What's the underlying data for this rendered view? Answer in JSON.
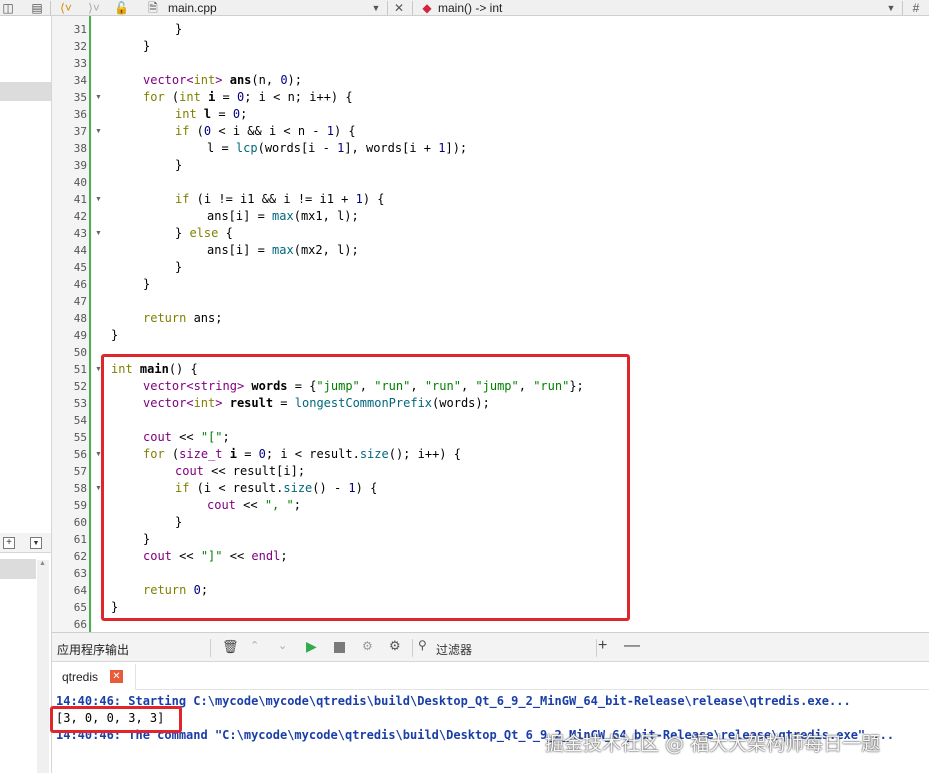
{
  "toolbar": {
    "file_tab": "main.cpp",
    "symbol": "main() -> int",
    "hash": "#"
  },
  "editor": {
    "lines": [
      {
        "n": "31",
        "indent": 2,
        "fold": false,
        "tokens": [
          {
            "t": "}"
          }
        ]
      },
      {
        "n": "32",
        "indent": 1,
        "fold": false,
        "tokens": [
          {
            "t": "}"
          }
        ]
      },
      {
        "n": "33",
        "indent": 0,
        "fold": false,
        "tokens": []
      },
      {
        "n": "34",
        "indent": 1,
        "fold": false,
        "tokens": [
          {
            "t": "vector<",
            "c": "ty"
          },
          {
            "t": "int",
            "c": "kw"
          },
          {
            "t": "> ",
            "c": "ty"
          },
          {
            "t": "ans",
            "c": "bd"
          },
          {
            "t": "(n, "
          },
          {
            "t": "0",
            "c": "nu"
          },
          {
            "t": ");"
          }
        ]
      },
      {
        "n": "35",
        "indent": 1,
        "fold": true,
        "tokens": [
          {
            "t": "for",
            "c": "kw"
          },
          {
            "t": " ("
          },
          {
            "t": "int",
            "c": "kw"
          },
          {
            "t": " "
          },
          {
            "t": "i",
            "c": "bd"
          },
          {
            "t": " = "
          },
          {
            "t": "0",
            "c": "nu"
          },
          {
            "t": "; i < n; i++) {"
          }
        ]
      },
      {
        "n": "36",
        "indent": 2,
        "fold": false,
        "tokens": [
          {
            "t": "int",
            "c": "kw"
          },
          {
            "t": " "
          },
          {
            "t": "l",
            "c": "bd"
          },
          {
            "t": " = "
          },
          {
            "t": "0",
            "c": "nu"
          },
          {
            "t": ";"
          }
        ]
      },
      {
        "n": "37",
        "indent": 2,
        "fold": true,
        "tokens": [
          {
            "t": "if",
            "c": "kw"
          },
          {
            "t": " ("
          },
          {
            "t": "0",
            "c": "nu"
          },
          {
            "t": " < i && i < n - "
          },
          {
            "t": "1",
            "c": "nu"
          },
          {
            "t": ") {"
          }
        ]
      },
      {
        "n": "38",
        "indent": 3,
        "fold": false,
        "tokens": [
          {
            "t": "l = "
          },
          {
            "t": "lcp",
            "c": "fn"
          },
          {
            "t": "(words[i - "
          },
          {
            "t": "1",
            "c": "nu"
          },
          {
            "t": "], words[i + "
          },
          {
            "t": "1",
            "c": "nu"
          },
          {
            "t": "]);"
          }
        ]
      },
      {
        "n": "39",
        "indent": 2,
        "fold": false,
        "tokens": [
          {
            "t": "}"
          }
        ]
      },
      {
        "n": "40",
        "indent": 0,
        "fold": false,
        "tokens": []
      },
      {
        "n": "41",
        "indent": 2,
        "fold": true,
        "tokens": [
          {
            "t": "if",
            "c": "kw"
          },
          {
            "t": " (i != i1 && i != i1 + "
          },
          {
            "t": "1",
            "c": "nu"
          },
          {
            "t": ") {"
          }
        ]
      },
      {
        "n": "42",
        "indent": 3,
        "fold": false,
        "tokens": [
          {
            "t": "ans[i] = "
          },
          {
            "t": "max",
            "c": "fn"
          },
          {
            "t": "(mx1, l);"
          }
        ]
      },
      {
        "n": "43",
        "indent": 2,
        "fold": true,
        "tokens": [
          {
            "t": "} "
          },
          {
            "t": "else",
            "c": "kw"
          },
          {
            "t": " {"
          }
        ]
      },
      {
        "n": "44",
        "indent": 3,
        "fold": false,
        "tokens": [
          {
            "t": "ans[i] = "
          },
          {
            "t": "max",
            "c": "fn"
          },
          {
            "t": "(mx2, l);"
          }
        ]
      },
      {
        "n": "45",
        "indent": 2,
        "fold": false,
        "tokens": [
          {
            "t": "}"
          }
        ]
      },
      {
        "n": "46",
        "indent": 1,
        "fold": false,
        "tokens": [
          {
            "t": "}"
          }
        ]
      },
      {
        "n": "47",
        "indent": 0,
        "fold": false,
        "tokens": []
      },
      {
        "n": "48",
        "indent": 1,
        "fold": false,
        "tokens": [
          {
            "t": "return",
            "c": "kw"
          },
          {
            "t": " ans;"
          }
        ]
      },
      {
        "n": "49",
        "indent": 0,
        "fold": false,
        "tokens": [
          {
            "t": "}"
          }
        ]
      },
      {
        "n": "50",
        "indent": 0,
        "fold": false,
        "tokens": []
      },
      {
        "n": "51",
        "indent": 0,
        "fold": true,
        "tokens": [
          {
            "t": "int",
            "c": "kw"
          },
          {
            "t": " "
          },
          {
            "t": "main",
            "c": "bd"
          },
          {
            "t": "() {"
          }
        ]
      },
      {
        "n": "52",
        "indent": 1,
        "fold": false,
        "tokens": [
          {
            "t": "vector<",
            "c": "ty"
          },
          {
            "t": "string",
            "c": "ty"
          },
          {
            "t": "> ",
            "c": "ty"
          },
          {
            "t": "words",
            "c": "bd"
          },
          {
            "t": " = {"
          },
          {
            "t": "\"jump\"",
            "c": "st"
          },
          {
            "t": ", "
          },
          {
            "t": "\"run\"",
            "c": "st"
          },
          {
            "t": ", "
          },
          {
            "t": "\"run\"",
            "c": "st"
          },
          {
            "t": ", "
          },
          {
            "t": "\"jump\"",
            "c": "st"
          },
          {
            "t": ", "
          },
          {
            "t": "\"run\"",
            "c": "st"
          },
          {
            "t": "};"
          }
        ]
      },
      {
        "n": "53",
        "indent": 1,
        "fold": false,
        "tokens": [
          {
            "t": "vector<",
            "c": "ty"
          },
          {
            "t": "int",
            "c": "kw"
          },
          {
            "t": "> ",
            "c": "ty"
          },
          {
            "t": "result",
            "c": "bd"
          },
          {
            "t": " = "
          },
          {
            "t": "longestCommonPrefix",
            "c": "fn"
          },
          {
            "t": "(words);"
          }
        ]
      },
      {
        "n": "54",
        "indent": 0,
        "fold": false,
        "tokens": []
      },
      {
        "n": "55",
        "indent": 1,
        "fold": false,
        "tokens": [
          {
            "t": "cout",
            "c": "ty"
          },
          {
            "t": " << "
          },
          {
            "t": "\"[\"",
            "c": "st"
          },
          {
            "t": ";"
          }
        ]
      },
      {
        "n": "56",
        "indent": 1,
        "fold": true,
        "tokens": [
          {
            "t": "for",
            "c": "kw"
          },
          {
            "t": " ("
          },
          {
            "t": "size_t",
            "c": "ty"
          },
          {
            "t": " "
          },
          {
            "t": "i",
            "c": "bd"
          },
          {
            "t": " = "
          },
          {
            "t": "0",
            "c": "nu"
          },
          {
            "t": "; i < result."
          },
          {
            "t": "size",
            "c": "fn"
          },
          {
            "t": "(); i++) {"
          }
        ]
      },
      {
        "n": "57",
        "indent": 2,
        "fold": false,
        "tokens": [
          {
            "t": "cout",
            "c": "ty"
          },
          {
            "t": " << result[i];"
          }
        ]
      },
      {
        "n": "58",
        "indent": 2,
        "fold": true,
        "tokens": [
          {
            "t": "if",
            "c": "kw"
          },
          {
            "t": " (i < result."
          },
          {
            "t": "size",
            "c": "fn"
          },
          {
            "t": "() - "
          },
          {
            "t": "1",
            "c": "nu"
          },
          {
            "t": ") {"
          }
        ]
      },
      {
        "n": "59",
        "indent": 3,
        "fold": false,
        "tokens": [
          {
            "t": "cout",
            "c": "ty"
          },
          {
            "t": " << "
          },
          {
            "t": "\", \"",
            "c": "st"
          },
          {
            "t": ";"
          }
        ]
      },
      {
        "n": "60",
        "indent": 2,
        "fold": false,
        "tokens": [
          {
            "t": "}"
          }
        ]
      },
      {
        "n": "61",
        "indent": 1,
        "fold": false,
        "tokens": [
          {
            "t": "}"
          }
        ]
      },
      {
        "n": "62",
        "indent": 1,
        "fold": false,
        "tokens": [
          {
            "t": "cout",
            "c": "ty"
          },
          {
            "t": " << "
          },
          {
            "t": "\"]\"",
            "c": "st"
          },
          {
            "t": " << "
          },
          {
            "t": "endl",
            "c": "ty"
          },
          {
            "t": ";"
          }
        ]
      },
      {
        "n": "63",
        "indent": 0,
        "fold": false,
        "tokens": []
      },
      {
        "n": "64",
        "indent": 1,
        "fold": false,
        "tokens": [
          {
            "t": "return",
            "c": "kw"
          },
          {
            "t": " "
          },
          {
            "t": "0",
            "c": "nu"
          },
          {
            "t": ";"
          }
        ]
      },
      {
        "n": "65",
        "indent": 0,
        "fold": false,
        "tokens": [
          {
            "t": "}"
          }
        ]
      },
      {
        "n": "66",
        "indent": 0,
        "fold": false,
        "tokens": []
      }
    ]
  },
  "output": {
    "title": "应用程序输出",
    "filter_placeholder": "过滤器",
    "tab_label": "qtredis",
    "lines": [
      {
        "text": "14:40:46: Starting C:\\mycode\\mycode\\qtredis\\build\\Desktop_Qt_6_9_2_MinGW_64_bit-Release\\release\\qtredis.exe...",
        "style": "blue"
      },
      {
        "text": "[3, 0, 0, 3, 3]",
        "style": "plain"
      },
      {
        "text": "14:40:46: The command \"C:\\mycode\\mycode\\qtredis\\build\\Desktop_Qt_6_9_2_MinGW_64_bit-Release\\release\\qtredis.exe\" ...",
        "style": "blue"
      }
    ]
  },
  "watermark": "掘金技术社区 @ 福大大架构师每日一题",
  "colors": {
    "annotation_red": "#e0262b",
    "modified_bar": "#4caf50",
    "run_green": "#2eae4a"
  }
}
